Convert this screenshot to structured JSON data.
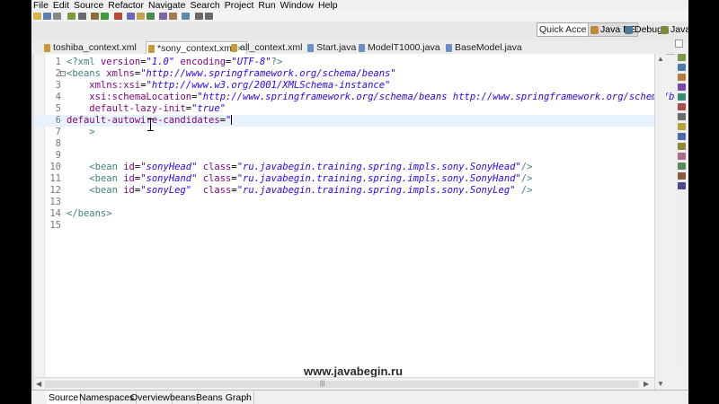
{
  "menu": [
    "File",
    "Edit",
    "Source",
    "Refactor",
    "Navigate",
    "Search",
    "Project",
    "Run",
    "Window",
    "Help"
  ],
  "toolbar_icons": [
    {
      "name": "new-icon",
      "color": "#d9b24c"
    },
    {
      "name": "save-icon",
      "color": "#5a7fb8"
    },
    {
      "name": "print-icon",
      "color": "#888888"
    },
    {
      "name": "server-icon",
      "color": "#7a9c3a"
    },
    {
      "name": "search-icon",
      "color": "#6b6b6b"
    },
    {
      "name": "debug-icon",
      "color": "#8a6e3a"
    },
    {
      "name": "run-icon",
      "color": "#3e9a3e"
    },
    {
      "name": "external-tools-icon",
      "color": "#b84a3a"
    },
    {
      "name": "new-java-project-icon",
      "color": "#6a6abf"
    },
    {
      "name": "new-package-icon",
      "color": "#c8a050"
    },
    {
      "name": "new-class-icon",
      "color": "#4a8a4a"
    },
    {
      "name": "open-type-icon",
      "color": "#7a6aa0"
    },
    {
      "name": "annotation-icon",
      "color": "#a07a50"
    },
    {
      "name": "edit-icon",
      "color": "#5a8ab0"
    },
    {
      "name": "back-icon",
      "color": "#6a6a6a"
    },
    {
      "name": "forward-icon",
      "color": "#6a6a6a"
    }
  ],
  "quick_access": {
    "placeholder": "Quick Acces"
  },
  "perspectives": [
    {
      "label": "Java EE",
      "active": true,
      "color": "#c08a3a"
    },
    {
      "label": "Debug",
      "active": false,
      "color": "#4a7a9a"
    },
    {
      "label": "Java",
      "active": false,
      "color": "#7a8a3a"
    }
  ],
  "editor_tabs": [
    {
      "label": "toshiba_context.xml",
      "active": false
    },
    {
      "label": "*sony_context.xml",
      "active": true
    },
    {
      "label": "all_context.xml",
      "active": false
    },
    {
      "label": "Start.java",
      "active": false
    },
    {
      "label": "ModelT1000.java",
      "active": false
    },
    {
      "label": "BaseModel.java",
      "active": false
    }
  ],
  "code_lines": [
    {
      "num": "1",
      "tokens": [
        {
          "t": "<?xml ",
          "c": "pi"
        },
        {
          "t": "version",
          "c": "attr"
        },
        {
          "t": "=",
          "c": "plain"
        },
        {
          "t": "\"1.0\"",
          "c": "val"
        },
        {
          "t": " ",
          "c": "plain"
        },
        {
          "t": "encoding",
          "c": "attr"
        },
        {
          "t": "=",
          "c": "plain"
        },
        {
          "t": "\"UTF-8\"",
          "c": "val"
        },
        {
          "t": "?>",
          "c": "pi"
        }
      ]
    },
    {
      "num": "2",
      "tokens": [
        {
          "t": "<beans ",
          "c": "tag"
        },
        {
          "t": "xmlns",
          "c": "attr"
        },
        {
          "t": "=",
          "c": "plain"
        },
        {
          "t": "\"http://www.springframework.org/schema/beans\"",
          "c": "val"
        }
      ]
    },
    {
      "num": "3",
      "tokens": [
        {
          "t": "    ",
          "c": "plain"
        },
        {
          "t": "xmlns:xsi",
          "c": "attr"
        },
        {
          "t": "=",
          "c": "plain"
        },
        {
          "t": "\"http://www.w3.org/2001/XMLSchema-instance\"",
          "c": "val"
        }
      ]
    },
    {
      "num": "4",
      "tokens": [
        {
          "t": "    ",
          "c": "plain"
        },
        {
          "t": "xsi:schemaLocation",
          "c": "attr"
        },
        {
          "t": "=",
          "c": "plain"
        },
        {
          "t": "\"http://www.springframework.org/schema/beans http://www.springframework.org/schema/beans/spring-beans.xsd\"",
          "c": "val"
        }
      ]
    },
    {
      "num": "5",
      "tokens": [
        {
          "t": "    ",
          "c": "plain"
        },
        {
          "t": "default-lazy-init",
          "c": "attr"
        },
        {
          "t": "=",
          "c": "plain"
        },
        {
          "t": "\"true\"",
          "c": "val"
        }
      ]
    },
    {
      "num": "6",
      "tokens": [
        {
          "t": "default-autowire-candidates",
          "c": "attr"
        },
        {
          "t": "=",
          "c": "plain"
        },
        {
          "t": "\"",
          "c": "val"
        }
      ]
    },
    {
      "num": "7",
      "tokens": [
        {
          "t": "    ",
          "c": "plain"
        },
        {
          "t": ">",
          "c": "tag"
        }
      ]
    },
    {
      "num": "8",
      "tokens": []
    },
    {
      "num": "9",
      "tokens": []
    },
    {
      "num": "10",
      "tokens": [
        {
          "t": "    ",
          "c": "plain"
        },
        {
          "t": "<bean ",
          "c": "tag"
        },
        {
          "t": "id",
          "c": "attr"
        },
        {
          "t": "=",
          "c": "plain"
        },
        {
          "t": "\"sonyHead\"",
          "c": "val"
        },
        {
          "t": " ",
          "c": "plain"
        },
        {
          "t": "class",
          "c": "attr"
        },
        {
          "t": "=",
          "c": "plain"
        },
        {
          "t": "\"ru.javabegin.training.spring.impls.sony.SonyHead\"",
          "c": "val"
        },
        {
          "t": "/>",
          "c": "tag"
        }
      ]
    },
    {
      "num": "11",
      "tokens": [
        {
          "t": "    ",
          "c": "plain"
        },
        {
          "t": "<bean ",
          "c": "tag"
        },
        {
          "t": "id",
          "c": "attr"
        },
        {
          "t": "=",
          "c": "plain"
        },
        {
          "t": "\"sonyHand\"",
          "c": "val"
        },
        {
          "t": " ",
          "c": "plain"
        },
        {
          "t": "class",
          "c": "attr"
        },
        {
          "t": "=",
          "c": "plain"
        },
        {
          "t": "\"ru.javabegin.training.spring.impls.sony.SonyHand\"",
          "c": "val"
        },
        {
          "t": "/>",
          "c": "tag"
        }
      ]
    },
    {
      "num": "12",
      "tokens": [
        {
          "t": "    ",
          "c": "plain"
        },
        {
          "t": "<bean ",
          "c": "tag"
        },
        {
          "t": "id",
          "c": "attr"
        },
        {
          "t": "=",
          "c": "plain"
        },
        {
          "t": "\"sonyLeg\"",
          "c": "val"
        },
        {
          "t": "  ",
          "c": "plain"
        },
        {
          "t": "class",
          "c": "attr"
        },
        {
          "t": "=",
          "c": "plain"
        },
        {
          "t": "\"ru.javabegin.training.spring.impls.sony.SonyLeg\"",
          "c": "val"
        },
        {
          "t": " />",
          "c": "tag"
        }
      ]
    },
    {
      "num": "13",
      "tokens": []
    },
    {
      "num": "14",
      "tokens": [
        {
          "t": "</beans>",
          "c": "tag"
        }
      ]
    },
    {
      "num": "15",
      "tokens": []
    }
  ],
  "current_line": "6",
  "watermark": "www.javabegin.ru",
  "bottom_tabs": [
    {
      "label": "Source",
      "active": true
    },
    {
      "label": "Namespaces",
      "active": false
    },
    {
      "label": "Overview",
      "active": false
    },
    {
      "label": "beans",
      "active": false
    },
    {
      "label": "Beans Graph",
      "active": false
    }
  ]
}
